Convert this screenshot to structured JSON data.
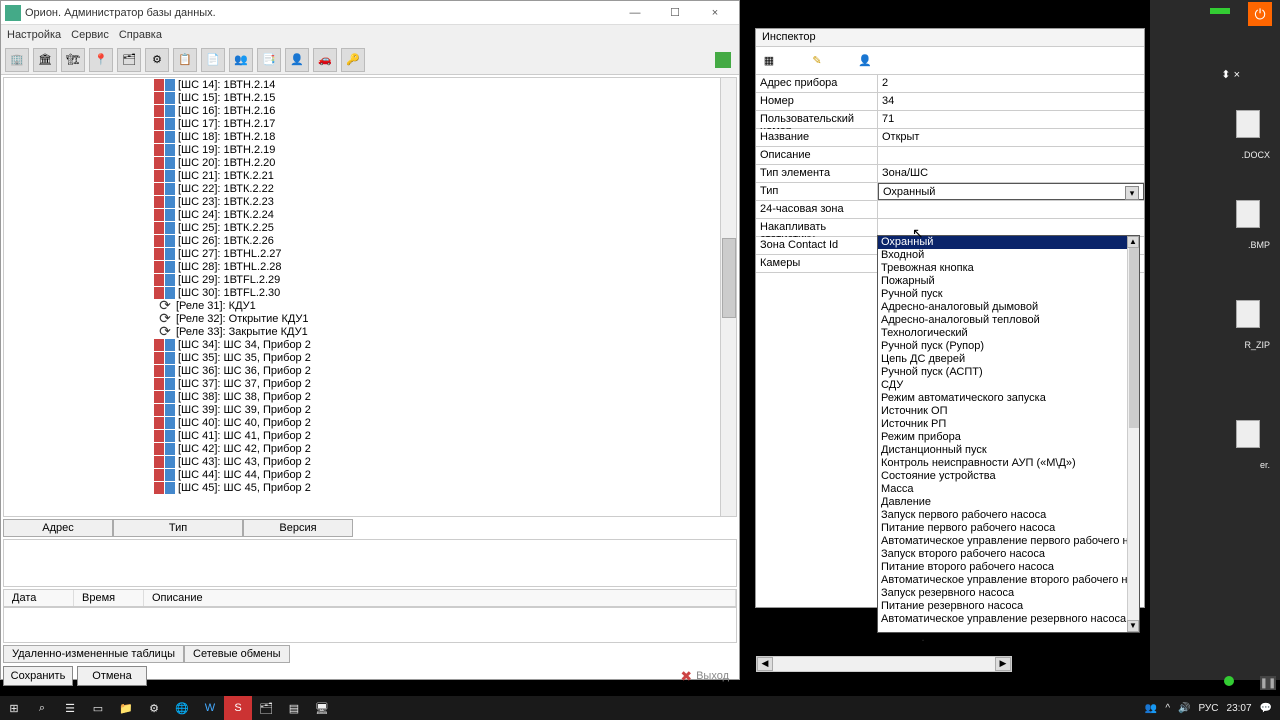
{
  "window": {
    "title": "Орион. Администратор базы данных.",
    "menu": [
      "Настройка",
      "Сервис",
      "Справка"
    ],
    "min": "—",
    "max": "☐",
    "close": "×"
  },
  "tree": [
    {
      "t": "s",
      "label": "[ШС 14]: 1ВТН.2.14"
    },
    {
      "t": "s",
      "label": "[ШС 15]: 1ВТН.2.15"
    },
    {
      "t": "s",
      "label": "[ШС 16]: 1ВТН.2.16"
    },
    {
      "t": "s",
      "label": "[ШС 17]: 1ВТН.2.17"
    },
    {
      "t": "s",
      "label": "[ШС 18]: 1ВТН.2.18"
    },
    {
      "t": "s",
      "label": "[ШС 19]: 1ВТН.2.19"
    },
    {
      "t": "s",
      "label": "[ШС 20]: 1ВТН.2.20"
    },
    {
      "t": "s",
      "label": "[ШС 21]: 1ВТК.2.21"
    },
    {
      "t": "s",
      "label": "[ШС 22]: 1ВТК.2.22"
    },
    {
      "t": "s",
      "label": "[ШС 23]: 1ВТК.2.23"
    },
    {
      "t": "s",
      "label": "[ШС 24]: 1ВТК.2.24"
    },
    {
      "t": "s",
      "label": "[ШС 25]: 1ВТК.2.25"
    },
    {
      "t": "s",
      "label": "[ШС 26]: 1ВТК.2.26"
    },
    {
      "t": "s",
      "label": "[ШС 27]: 1ВТHL.2.27"
    },
    {
      "t": "s",
      "label": "[ШС 28]: 1ВТHL.2.28"
    },
    {
      "t": "s",
      "label": "[ШС 29]: 1ВТFL.2.29"
    },
    {
      "t": "s",
      "label": "[ШС 30]: 1ВТFL.2.30"
    },
    {
      "t": "r",
      "label": "[Реле 31]: КДУ1"
    },
    {
      "t": "r",
      "label": "[Реле 32]: Открытие КДУ1"
    },
    {
      "t": "r",
      "label": "[Реле 33]: Закрытие КДУ1"
    },
    {
      "t": "s",
      "label": "[ШС 34]: ШС 34, Прибор 2"
    },
    {
      "t": "s",
      "label": "[ШС 35]: ШС 35, Прибор 2"
    },
    {
      "t": "s",
      "label": "[ШС 36]: ШС 36, Прибор 2"
    },
    {
      "t": "s",
      "label": "[ШС 37]: ШС 37, Прибор 2"
    },
    {
      "t": "s",
      "label": "[ШС 38]: ШС 38, Прибор 2"
    },
    {
      "t": "s",
      "label": "[ШС 39]: ШС 39, Прибор 2"
    },
    {
      "t": "s",
      "label": "[ШС 40]: ШС 40, Прибор 2"
    },
    {
      "t": "s",
      "label": "[ШС 41]: ШС 41, Прибор 2"
    },
    {
      "t": "s",
      "label": "[ШС 42]: ШС 42, Прибор 2"
    },
    {
      "t": "s",
      "label": "[ШС 43]: ШС 43, Прибор 2"
    },
    {
      "t": "s",
      "label": "[ШС 44]: ШС 44, Прибор 2"
    },
    {
      "t": "s",
      "label": "[ШС 45]: ШС 45, Прибор 2"
    }
  ],
  "grid_cols": {
    "c1": "Адрес",
    "c2": "Тип",
    "c3": "Версия"
  },
  "log_cols": {
    "c1": "Дата",
    "c2": "Время",
    "c3": "Описание"
  },
  "tabs": {
    "t1": "Удаленно-измененные таблицы",
    "t2": "Сетевые обмены"
  },
  "footer": {
    "save": "Сохранить",
    "cancel": "Отмена",
    "exit": "Выход"
  },
  "inspector": {
    "title": "Инспектор",
    "rows": [
      {
        "k": "Адрес прибора",
        "v": "2"
      },
      {
        "k": "Номер",
        "v": "34"
      },
      {
        "k": "Пользовательский номер",
        "v": "71"
      },
      {
        "k": "Название",
        "v": "Открыт"
      },
      {
        "k": "Описание",
        "v": ""
      },
      {
        "k": "Тип элемента",
        "v": "Зона/ШС"
      },
      {
        "k": "Тип",
        "v": "Охранный",
        "dd": true
      },
      {
        "k": "24-часовая зона",
        "v": ""
      },
      {
        "k": "Накапливать статистику",
        "v": ""
      },
      {
        "k": "Зона Contact Id",
        "v": ""
      },
      {
        "k": "Камеры",
        "v": ""
      }
    ]
  },
  "dropdown": [
    "Охранный",
    "Входной",
    "Тревожная кнопка",
    "Пожарный",
    "Ручной пуск",
    "Адресно-аналоговый дымовой",
    "Адресно-аналоговый тепловой",
    "Технологический",
    "Ручной пуск (Рупор)",
    "Цепь ДС дверей",
    "Ручной пуск (АСПТ)",
    "СДУ",
    "Режим автоматического запуска",
    "Источник ОП",
    "Источник РП",
    "Режим прибора",
    "Дистанционный пуск",
    "Контроль неисправности АУП («М\\Д»)",
    "Состояние устройства",
    "Масса",
    "Давление",
    "Запуск первого рабочего насоса",
    "Питание первого рабочего насоса",
    "Автоматическое управление первого рабочего насоса",
    "Запуск второго рабочего насоса",
    "Питание второго рабочего насоса",
    "Автоматическое управление второго рабочего насоса",
    "Запуск резервного насоса",
    "Питание резервного насоса",
    "Автоматическое управление резервного насоса"
  ],
  "right": {
    "l1": ".DOCX",
    "l2": ".BMP",
    "l3": "R_ZIP",
    "l4": "er."
  },
  "taskbar": {
    "lang": "РУС",
    "time": "23:07"
  }
}
